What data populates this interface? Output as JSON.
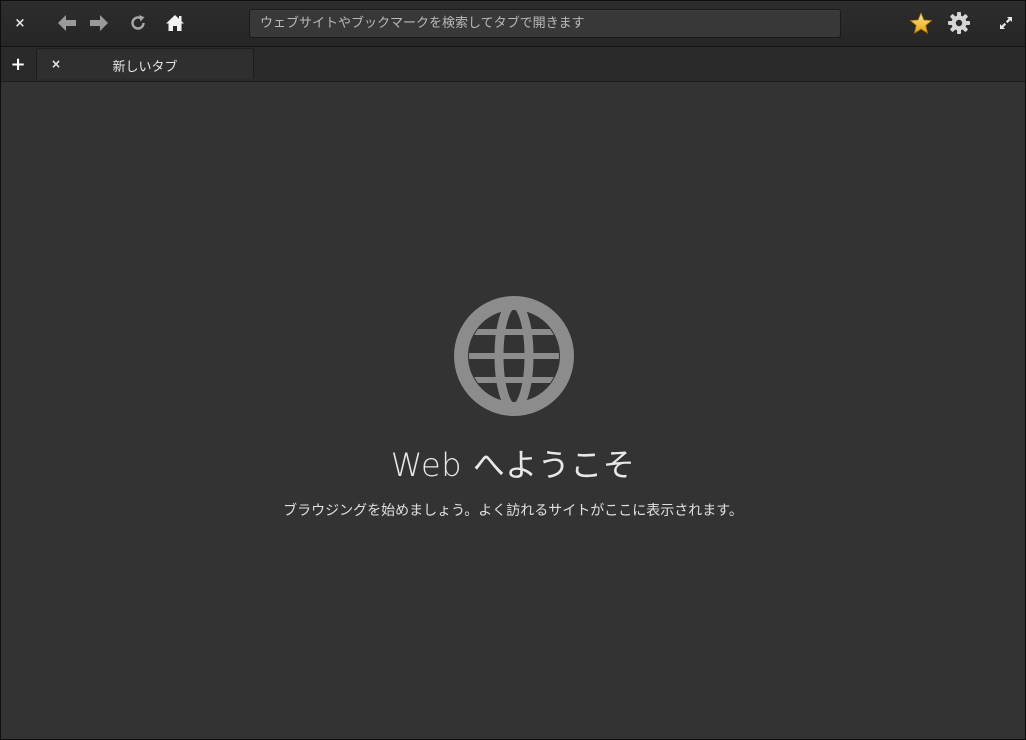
{
  "window": {
    "close_glyph": "×"
  },
  "toolbar": {
    "icons": {
      "back": "back-arrow-icon",
      "forward": "forward-arrow-icon",
      "reload": "reload-icon",
      "home": "home-icon",
      "bookmarks": "star-icon",
      "settings": "gear-icon",
      "fullscreen": "fullscreen-icon"
    },
    "search_placeholder": "ウェブサイトやブックマークを検索してタブで開きます",
    "search_value": ""
  },
  "tabs": {
    "new_tab_glyph": "+",
    "items": [
      {
        "title": "新しいタブ",
        "close_glyph": "×"
      }
    ]
  },
  "welcome": {
    "title": "Web へようこそ",
    "subtitle": "ブラウジングを始めましょう。よく訪れるサイトがここに表示されます。",
    "icon": "globe-icon"
  },
  "colors": {
    "background": "#333333",
    "headerbar": "#2a2a2a",
    "globe": "#8a8a8a",
    "star": "#f5c518"
  }
}
